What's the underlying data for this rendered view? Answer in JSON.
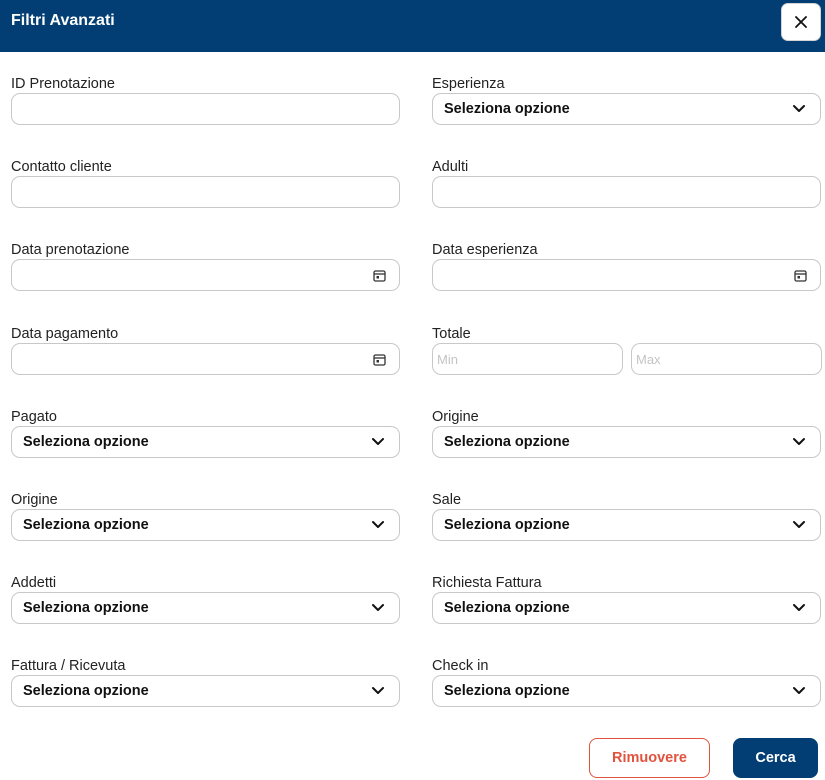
{
  "header": {
    "title": "Filtri Avanzati",
    "close_icon": "close-icon"
  },
  "fields": {
    "id_prenotazione": {
      "label": "ID Prenotazione",
      "value": ""
    },
    "esperienza": {
      "label": "Esperienza",
      "selected": "Seleziona opzione"
    },
    "contatto_cliente": {
      "label": "Contatto cliente",
      "value": ""
    },
    "adulti": {
      "label": "Adulti",
      "value": ""
    },
    "data_prenotazione": {
      "label": "Data prenotazione",
      "value": ""
    },
    "data_esperienza": {
      "label": "Data esperienza",
      "value": ""
    },
    "data_pagamento": {
      "label": "Data pagamento",
      "value": ""
    },
    "totale": {
      "label": "Totale",
      "min_placeholder": "Min",
      "max_placeholder": "Max"
    },
    "pagato": {
      "label": "Pagato",
      "selected": "Seleziona opzione"
    },
    "origine_right": {
      "label": "Origine",
      "selected": "Seleziona opzione"
    },
    "origine_left": {
      "label": "Origine",
      "selected": "Seleziona opzione"
    },
    "sale": {
      "label": "Sale",
      "selected": "Seleziona opzione"
    },
    "addetti": {
      "label": "Addetti",
      "selected": "Seleziona opzione"
    },
    "richiesta_fattura": {
      "label": "Richiesta Fattura",
      "selected": "Seleziona opzione"
    },
    "fattura_ricevuta": {
      "label": "Fattura / Ricevuta",
      "selected": "Seleziona opzione"
    },
    "check_in": {
      "label": "Check in",
      "selected": "Seleziona opzione"
    }
  },
  "actions": {
    "remove_label": "Rimuovere",
    "search_label": "Cerca"
  },
  "colors": {
    "primary": "#023e73",
    "danger": "#e0533d",
    "border": "#c8c8c8"
  }
}
